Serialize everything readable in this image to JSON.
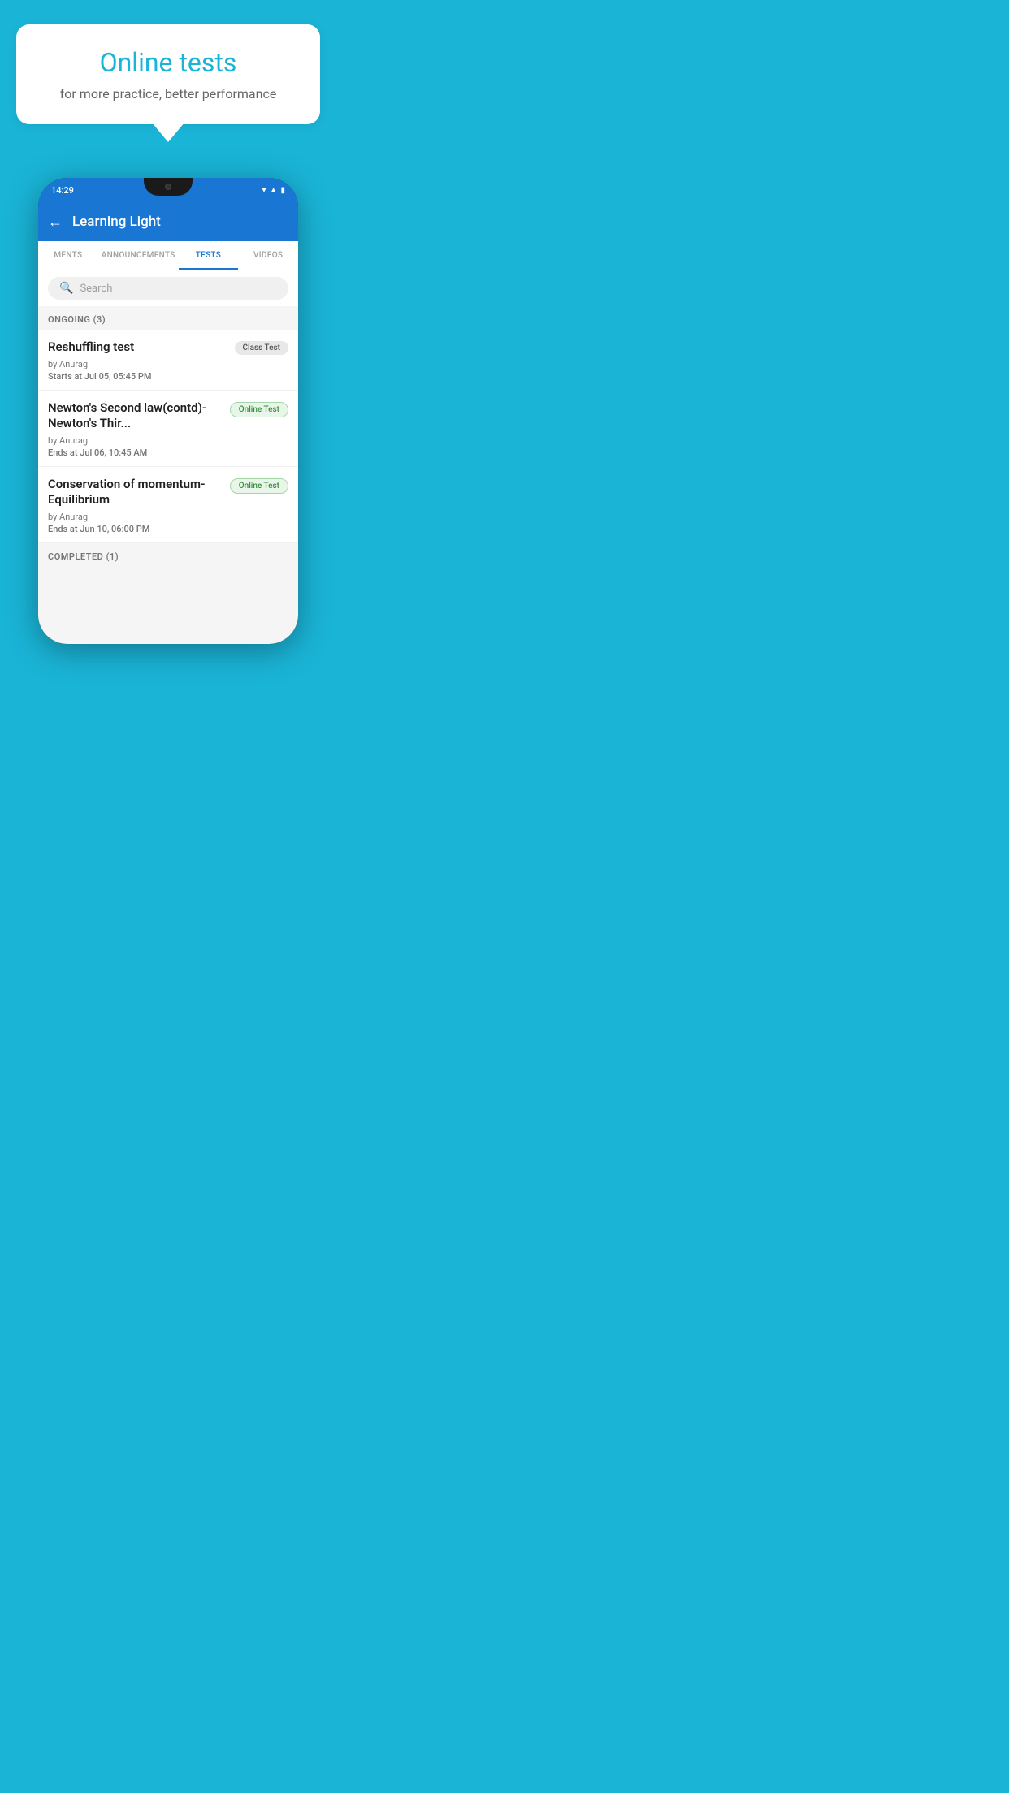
{
  "background": {
    "color": "#1ab4d7"
  },
  "speech_bubble": {
    "title": "Online tests",
    "subtitle": "for more practice, better performance"
  },
  "phone": {
    "status_bar": {
      "time": "14:29",
      "icons": [
        "wifi",
        "signal",
        "battery"
      ]
    },
    "app_bar": {
      "back_label": "←",
      "title": "Learning Light"
    },
    "tabs": [
      {
        "label": "MENTS",
        "active": false
      },
      {
        "label": "ANNOUNCEMENTS",
        "active": false
      },
      {
        "label": "TESTS",
        "active": true
      },
      {
        "label": "VIDEOS",
        "active": false
      }
    ],
    "search": {
      "placeholder": "Search"
    },
    "ongoing_section": {
      "label": "ONGOING (3)"
    },
    "test_items": [
      {
        "title": "Reshuffling test",
        "badge": "Class Test",
        "badge_type": "class",
        "by": "by Anurag",
        "time_label": "Starts at",
        "time_value": "Jul 05, 05:45 PM"
      },
      {
        "title": "Newton's Second law(contd)-Newton's Thir...",
        "badge": "Online Test",
        "badge_type": "online",
        "by": "by Anurag",
        "time_label": "Ends at",
        "time_value": "Jul 06, 10:45 AM"
      },
      {
        "title": "Conservation of momentum-Equilibrium",
        "badge": "Online Test",
        "badge_type": "online",
        "by": "by Anurag",
        "time_label": "Ends at",
        "time_value": "Jun 10, 06:00 PM"
      }
    ],
    "completed_section": {
      "label": "COMPLETED (1)"
    }
  }
}
